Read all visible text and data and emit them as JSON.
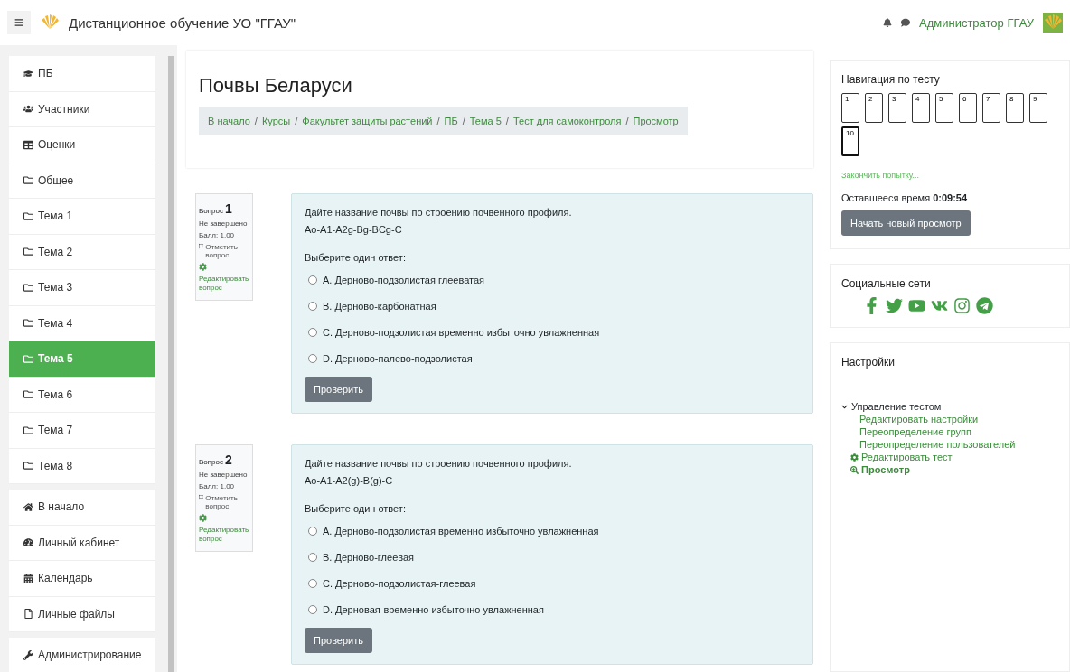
{
  "header": {
    "site_title": "Дистанционное обучение УО \"ГГАУ\"",
    "user_name": "Администратор ГГАУ"
  },
  "sidebar": {
    "groups": [
      {
        "items": [
          {
            "label": "ПБ",
            "kind": "course",
            "selected": false
          },
          {
            "label": "Участники",
            "kind": "users",
            "selected": false
          },
          {
            "label": "Оценки",
            "kind": "grades",
            "selected": false
          },
          {
            "label": "Общее",
            "kind": "folder",
            "selected": false
          },
          {
            "label": "Тема 1",
            "kind": "folder",
            "selected": false
          },
          {
            "label": "Тема 2",
            "kind": "folder",
            "selected": false
          },
          {
            "label": "Тема 3",
            "kind": "folder",
            "selected": false
          },
          {
            "label": "Тема 4",
            "kind": "folder",
            "selected": false
          },
          {
            "label": "Тема 5",
            "kind": "folder",
            "selected": true
          },
          {
            "label": "Тема 6",
            "kind": "folder",
            "selected": false
          },
          {
            "label": "Тема 7",
            "kind": "folder",
            "selected": false
          },
          {
            "label": "Тема 8",
            "kind": "folder",
            "selected": false
          }
        ]
      },
      {
        "items": [
          {
            "label": "В начало",
            "kind": "home",
            "selected": false
          },
          {
            "label": "Личный кабинет",
            "kind": "dashboard",
            "selected": false
          },
          {
            "label": "Календарь",
            "kind": "calendar",
            "selected": false
          },
          {
            "label": "Личные файлы",
            "kind": "file",
            "selected": false
          }
        ]
      },
      {
        "items": [
          {
            "label": "Администрирование",
            "kind": "wrench",
            "selected": false
          }
        ]
      }
    ]
  },
  "page": {
    "title": "Почвы Беларуси",
    "separator": "/",
    "breadcrumb": [
      "В начало",
      "Курсы",
      "Факультет защиты растений",
      "ПБ",
      "Тема 5",
      "Тест для самоконтроля",
      "Просмотр"
    ]
  },
  "questions": [
    {
      "label": "Вопрос",
      "number": "1",
      "status": "Не завершено",
      "score": "Балл: 1,00",
      "flag": "Отметить вопрос",
      "edit": "Редактировать вопрос",
      "text": "Дайте название почвы по строению почвенного профиля.",
      "formula": "Ао-А1-А2g-Bg-BCg-C",
      "prompt": "Выберите один ответ:",
      "options": [
        {
          "text": "A. Дерново-подзолистая глееватая",
          "checked": false
        },
        {
          "text": "B. Дерново-карбонатная",
          "checked": false
        },
        {
          "text": "C. Дерново-подзолистая временно избыточно увлажненная",
          "checked": false
        },
        {
          "text": "D. Дерново-палево-подзолистая",
          "checked": false
        }
      ],
      "button": "Проверить"
    },
    {
      "label": "Вопрос",
      "number": "2",
      "status": "Не завершено",
      "score": "Балл: 1.00",
      "flag": "Отметить вопрос",
      "edit": "Редактировать вопрос",
      "text": "Дайте название почвы по строению почвенного профиля.",
      "formula": "Ао-А1-А2(g)-B(g)-C",
      "prompt": "Выберите один ответ:",
      "options": [
        {
          "text": "A. Дерново-подзолистая временно избыточно увлажненная",
          "checked": false
        },
        {
          "text": "B. Дерново-глеевая",
          "checked": false
        },
        {
          "text": "C. Дерново-подзолистая-глеевая",
          "checked": false
        },
        {
          "text": "D. Дерновая-временно избыточно увлажненная",
          "checked": false
        }
      ],
      "button": "Проверить"
    }
  ],
  "quiz_nav": {
    "title": "Навигация по тесту",
    "pages": [
      {
        "label": "1",
        "selected": false
      },
      {
        "label": "2",
        "selected": false
      },
      {
        "label": "3",
        "selected": false
      },
      {
        "label": "4",
        "selected": false
      },
      {
        "label": "5",
        "selected": false
      },
      {
        "label": "6",
        "selected": false
      },
      {
        "label": "7",
        "selected": false
      },
      {
        "label": "8",
        "selected": false
      },
      {
        "label": "9",
        "selected": false
      },
      {
        "label": "10",
        "selected": true
      }
    ],
    "finish_link": "Закончить попытку...",
    "time_label": "Оставшееся время",
    "time_value": "0:09:54",
    "restart_button": "Начать новый просмотр"
  },
  "social": {
    "title": "Социальные сети",
    "icons": [
      {
        "kind": "facebook"
      },
      {
        "kind": "twitter"
      },
      {
        "kind": "youtube"
      },
      {
        "kind": "vk"
      },
      {
        "kind": "instagram"
      },
      {
        "kind": "telegram"
      }
    ]
  },
  "settings": {
    "title": "Настройки",
    "group": {
      "label": "Управление тестом",
      "expanded": true,
      "children": [
        {
          "label": "Редактировать настройки"
        },
        {
          "label": "Переопределение групп"
        },
        {
          "label": "Переопределение пользователей"
        }
      ]
    },
    "links": [
      {
        "label": "Редактировать тест",
        "kind": "edit"
      },
      {
        "label": "Просмотр",
        "kind": "preview"
      }
    ]
  }
}
